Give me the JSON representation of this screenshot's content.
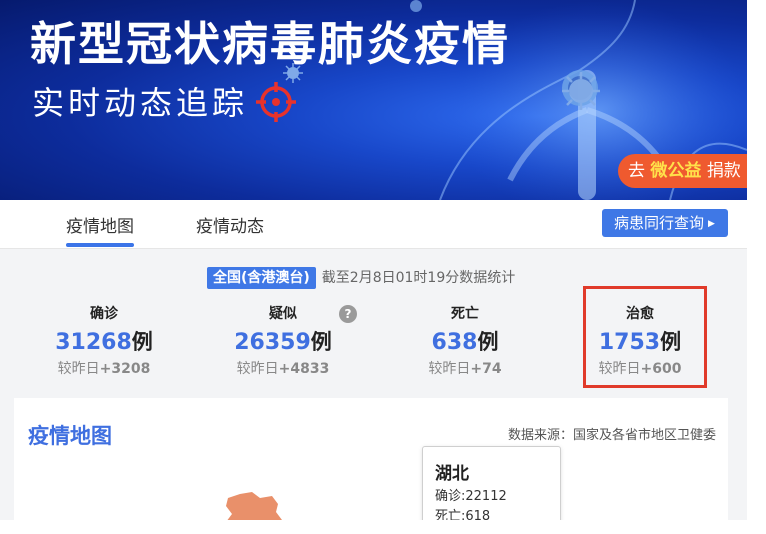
{
  "banner": {
    "title": "新型冠状病毒肺炎疫情",
    "subtitle": "实时动态追踪",
    "donate_prefix": "去",
    "donate_brand": "微公益",
    "donate_suffix": "捐款"
  },
  "tabs": [
    {
      "label": "疫情地图",
      "active": true
    },
    {
      "label": "疫情动态",
      "active": false
    }
  ],
  "query_button": "病患同行查询",
  "scope": {
    "tag": "全国(含港澳台)",
    "note": "截至2月8日01时19分数据统计"
  },
  "stats": [
    {
      "label": "确诊",
      "value": "31268",
      "unit": "例",
      "delta_label": "较昨日",
      "delta": "+3208"
    },
    {
      "label": "疑似",
      "value": "26359",
      "unit": "例",
      "delta_label": "较昨日",
      "delta": "+4833"
    },
    {
      "label": "死亡",
      "value": "638",
      "unit": "例",
      "delta_label": "较昨日",
      "delta": "+74"
    },
    {
      "label": "治愈",
      "value": "1753",
      "unit": "例",
      "delta_label": "较昨日",
      "delta": "+600"
    }
  ],
  "help_icon_glyph": "?",
  "map": {
    "title": "疫情地图",
    "source": "数据来源：国家及各省市地区卫健委",
    "tooltip": {
      "region": "湖北",
      "confirmed": "确诊:22112",
      "deaths": "死亡:618"
    }
  },
  "colors": {
    "accent": "#3f78e6",
    "highlight": "#e03a2a",
    "donate": "#ef5a2f"
  }
}
